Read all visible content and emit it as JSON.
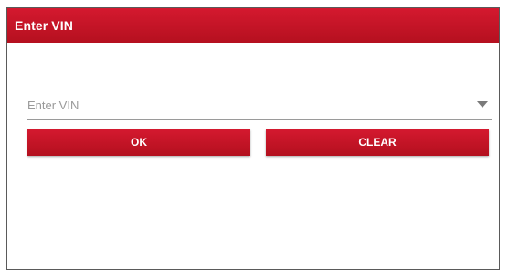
{
  "dialog": {
    "title": "Enter VIN"
  },
  "vin": {
    "placeholder": "Enter VIN",
    "value": "",
    "dropdown_icon": "chevron-down-icon"
  },
  "buttons": {
    "ok_label": "OK",
    "clear_label": "CLEAR"
  },
  "colors": {
    "accent": "#c8102e",
    "title_text": "#ffffff",
    "placeholder": "#9a9a9a"
  }
}
